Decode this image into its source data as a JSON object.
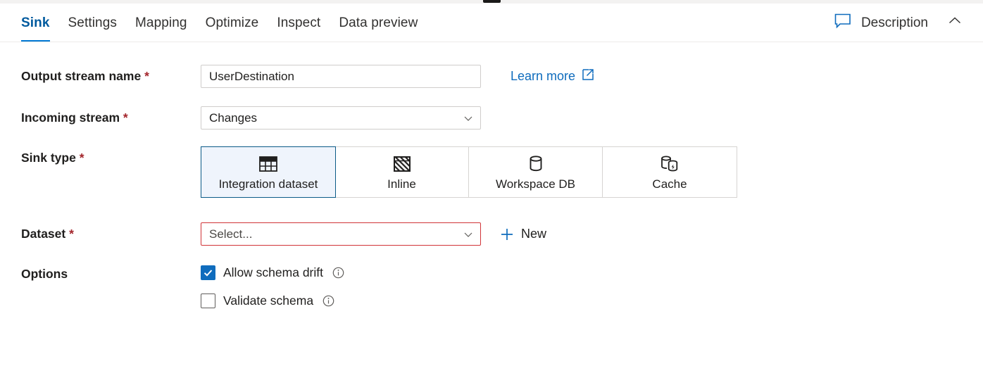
{
  "window": {
    "drag_handle": "panel-drag-handle"
  },
  "header": {
    "tabs": [
      {
        "label": "Sink",
        "active": true
      },
      {
        "label": "Settings",
        "active": false
      },
      {
        "label": "Mapping",
        "active": false
      },
      {
        "label": "Optimize",
        "active": false
      },
      {
        "label": "Inspect",
        "active": false
      },
      {
        "label": "Data preview",
        "active": false
      }
    ],
    "description_label": "Description",
    "description_icon": "comment-icon",
    "collapse_icon": "chevron-up-icon"
  },
  "form": {
    "output_stream": {
      "label": "Output stream name",
      "required": "*",
      "value": "UserDestination",
      "placeholder": "",
      "learn_more": {
        "label": "Learn more",
        "icon": "external-link-icon"
      }
    },
    "incoming_stream": {
      "label": "Incoming stream",
      "required": "*",
      "value": "Changes",
      "icon": "chevron-down-icon"
    },
    "sink_type": {
      "label": "Sink type",
      "required": "*",
      "options": [
        {
          "label": "Integration dataset",
          "icon": "table-grid-icon",
          "selected": true
        },
        {
          "label": "Inline",
          "icon": "hatched-table-icon",
          "selected": false
        },
        {
          "label": "Workspace DB",
          "icon": "database-cylinder-icon",
          "selected": false
        },
        {
          "label": "Cache",
          "icon": "cache-database-bolt-icon",
          "selected": false
        }
      ]
    },
    "dataset": {
      "label": "Dataset",
      "required": "*",
      "value": "Select...",
      "error": true,
      "icon": "chevron-down-icon",
      "new_button": {
        "label": "New",
        "icon": "plus-icon"
      }
    },
    "options": {
      "label": "Options",
      "items": [
        {
          "label": "Allow schema drift",
          "checked": true,
          "info_icon": "info-icon"
        },
        {
          "label": "Validate schema",
          "checked": false,
          "info_icon": "info-icon"
        }
      ]
    }
  },
  "colors": {
    "accent": "#0078d4",
    "link": "#0f6cbd",
    "required": "#a4262c",
    "error": "#d13438",
    "selected_tile_bg": "#eff4fc",
    "selected_tile_border": "#0b5a87"
  }
}
